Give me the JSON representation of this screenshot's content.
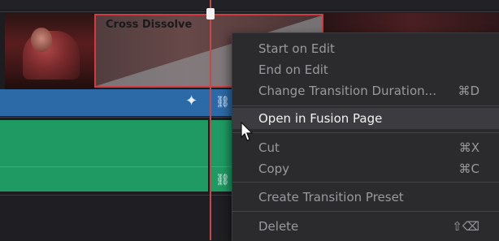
{
  "timeline": {
    "transition": {
      "label": "Cross Dissolve"
    },
    "playhead_color": "#c24a4a",
    "video_track_color": "#2b6aa6",
    "audio_track_color": "#1f9a62",
    "transition_border_color": "#d23b3d",
    "icons": {
      "effects": "sparkle-icon",
      "link_video": "link-icon",
      "link_audio": "link-icon"
    }
  },
  "context_menu": {
    "items": [
      {
        "label": "Start on Edit",
        "shortcut": ""
      },
      {
        "label": "End on Edit",
        "shortcut": ""
      },
      {
        "label": "Change Transition Duration...",
        "shortcut": "⌘D"
      },
      {
        "label": "Open in Fusion Page",
        "shortcut": "",
        "highlighted": true
      },
      {
        "label": "Cut",
        "shortcut": "⌘X"
      },
      {
        "label": "Copy",
        "shortcut": "⌘C"
      },
      {
        "label": "Create Transition Preset",
        "shortcut": ""
      },
      {
        "label": "Delete",
        "shortcut": "⇧⌫"
      }
    ]
  }
}
